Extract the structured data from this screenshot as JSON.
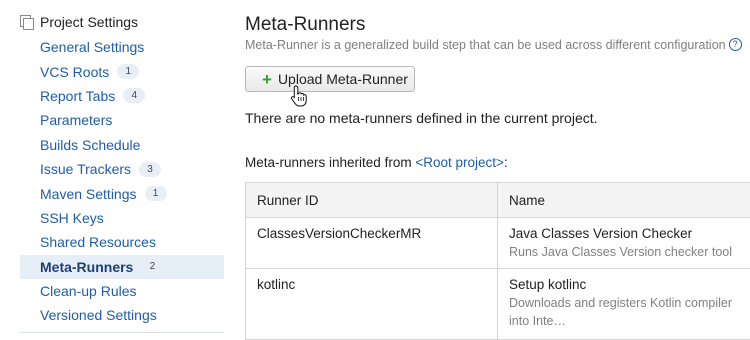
{
  "sidebar": {
    "header": "Project Settings",
    "items": [
      {
        "label": "General Settings",
        "badge": ""
      },
      {
        "label": "VCS Roots",
        "badge": "1"
      },
      {
        "label": "Report Tabs",
        "badge": "4"
      },
      {
        "label": "Parameters",
        "badge": ""
      },
      {
        "label": "Builds Schedule",
        "badge": ""
      },
      {
        "label": "Issue Trackers",
        "badge": "3"
      },
      {
        "label": "Maven Settings",
        "badge": "1"
      },
      {
        "label": "SSH Keys",
        "badge": ""
      },
      {
        "label": "Shared Resources",
        "badge": ""
      },
      {
        "label": "Meta-Runners",
        "badge": "2",
        "active": true
      },
      {
        "label": "Clean-up Rules",
        "badge": ""
      },
      {
        "label": "Versioned Settings",
        "badge": ""
      }
    ]
  },
  "main": {
    "title": "Meta-Runners",
    "subtitle": "Meta-Runner is a generalized build step that can be used across different configuration",
    "upload_label": "Upload Meta-Runner",
    "empty_message": "There are no meta-runners defined in the current project.",
    "inherited_prefix": "Meta-runners inherited from ",
    "inherited_link": "<Root project>",
    "inherited_suffix": ":"
  },
  "table": {
    "headers": [
      "Runner ID",
      "Name"
    ],
    "rows": [
      {
        "id": "ClassesVersionCheckerMR",
        "name": "Java Classes Version Checker",
        "description": "Runs Java Classes Version checker tool"
      },
      {
        "id": "kotlinc",
        "name": "Setup kotlinc",
        "description": "Downloads and registers Kotlin compiler into Inte…"
      }
    ]
  },
  "colors": {
    "link": "#1f5da8",
    "active_bg": "#e6eef8",
    "plus": "#2fa52f"
  }
}
